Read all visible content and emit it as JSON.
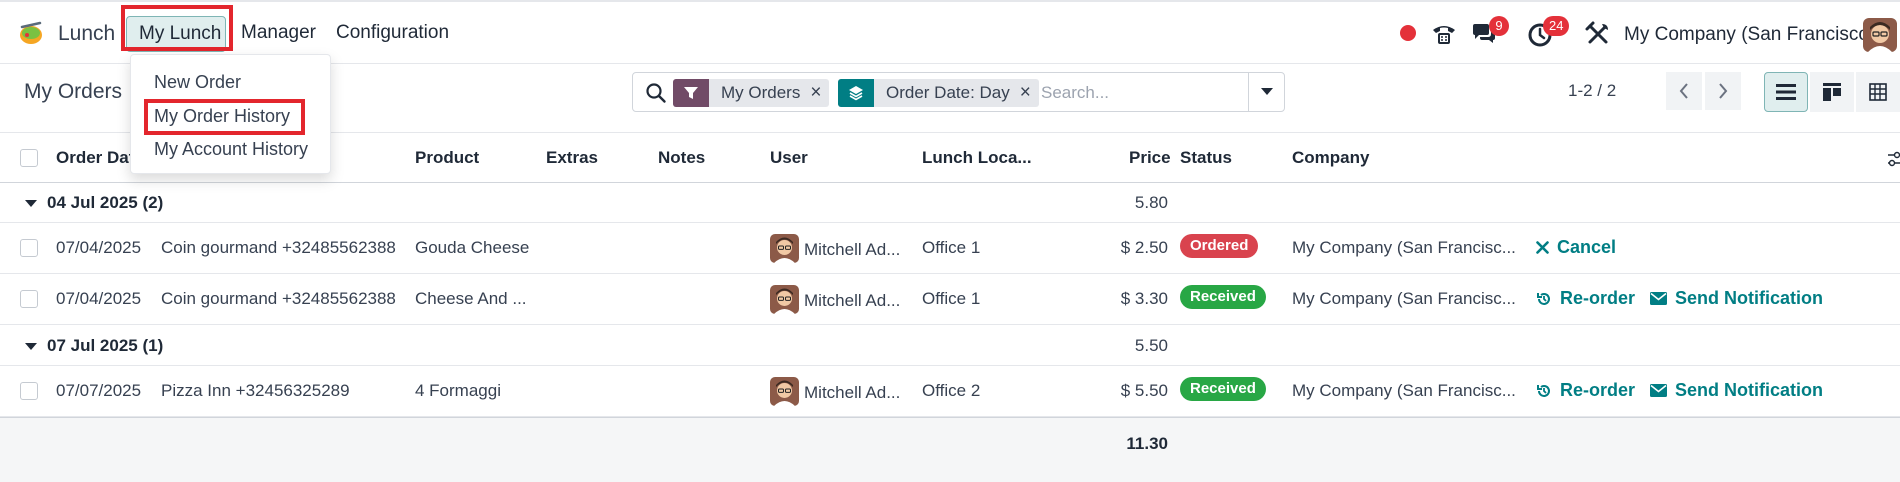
{
  "navbar": {
    "app_name": "Lunch",
    "menu": [
      "My Lunch",
      "Manager",
      "Configuration"
    ],
    "messages_count": "9",
    "activities_count": "24",
    "company": "My Company (San Francisco)"
  },
  "dropdown": {
    "items": [
      "New Order",
      "My Order History",
      "My Account History"
    ]
  },
  "control": {
    "title": "My Orders",
    "facets": [
      "My Orders",
      "Order Date: Day"
    ],
    "search_placeholder": "Search...",
    "pager": "1-2 / 2"
  },
  "list": {
    "columns": [
      "Order Date",
      "Product",
      "Extras",
      "Notes",
      "User",
      "Lunch Loca...",
      "Price",
      "Status",
      "Company"
    ],
    "groups": [
      {
        "label": "04 Jul 2025 (2)",
        "total": "5.80",
        "rows": [
          {
            "date": "07/04/2025",
            "vendor": "Coin gourmand +32485562388",
            "product": "Gouda Cheese",
            "user": "Mitchell Ad...",
            "location": "Office 1",
            "price": "$ 2.50",
            "status": "Ordered",
            "company": "My Company (San Francisc...",
            "actions": [
              "Cancel"
            ]
          },
          {
            "date": "07/04/2025",
            "vendor": "Coin gourmand +32485562388",
            "product": "Cheese And ...",
            "user": "Mitchell Ad...",
            "location": "Office 1",
            "price": "$ 3.30",
            "status": "Received",
            "company": "My Company (San Francisc...",
            "actions": [
              "Re-order",
              "Send Notification"
            ]
          }
        ]
      },
      {
        "label": "07 Jul 2025 (1)",
        "total": "5.50",
        "rows": [
          {
            "date": "07/07/2025",
            "vendor": "Pizza Inn +32456325289",
            "product": "4 Formaggi",
            "user": "Mitchell Ad...",
            "location": "Office 2",
            "price": "$ 5.50",
            "status": "Received",
            "company": "My Company (San Francisc...",
            "actions": [
              "Re-order",
              "Send Notification"
            ]
          }
        ]
      }
    ],
    "grand_total": "11.30"
  },
  "colors": {
    "accent": "#017e84",
    "ordered_badge": "#d9434e",
    "received_badge": "#28a745",
    "highlight": "#e3262d",
    "filter_facet": "#714b67",
    "groupby_facet": "#017e84"
  },
  "icons": {
    "search": "search-icon",
    "filter": "filter-icon",
    "groupby": "layers-icon",
    "phone": "phone-icon",
    "chat": "chat-icon",
    "activity": "clock-icon",
    "tools": "tools-icon"
  }
}
